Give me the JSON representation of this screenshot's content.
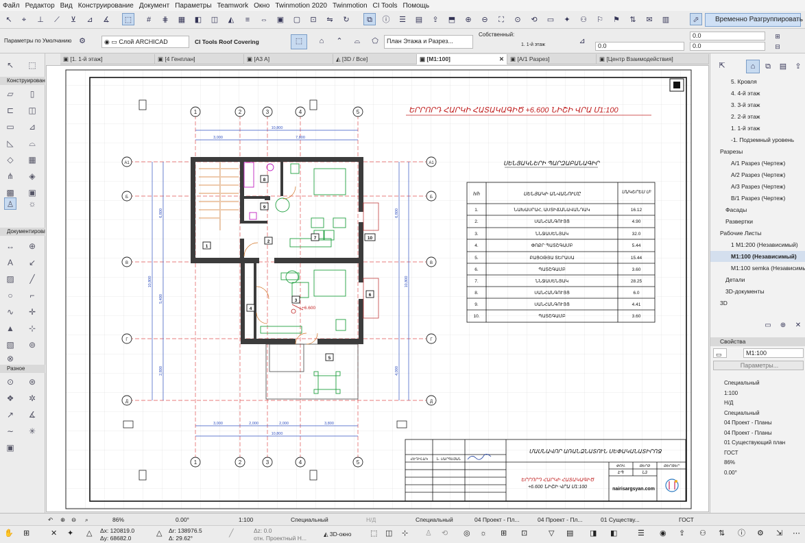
{
  "menu": [
    "Файл",
    "Редактор",
    "Вид",
    "Конструирование",
    "Документ",
    "Параметры",
    "Teamwork",
    "Окно",
    "Twinmotion 2020",
    "Twinmotion",
    "CI Tools",
    "Помощь"
  ],
  "toolbar1": {
    "regroup_label": "Временно Разгруппировать"
  },
  "toolbar2": {
    "defaults_label": "Параметры по Умолчанию",
    "layer": "Слой ARCHICAD",
    "ci_tools": "CI Tools Roof Covering",
    "view_mode": "План Этажа и Разрез...",
    "own_label": "Собственный:",
    "story": "1. 1-й этаж",
    "input1": "0.0",
    "input2": "0.0",
    "input3": "0.0"
  },
  "tabs": [
    {
      "label": "[1. 1-й этаж]"
    },
    {
      "label": "[4 Генплан]"
    },
    {
      "label": "[A3 A]"
    },
    {
      "label": "[3D / Все]"
    },
    {
      "label": "[M1:100]"
    },
    {
      "label": "[A/1 Разрез]"
    },
    {
      "label": "[Центр Взаимодействия]"
    }
  ],
  "left": {
    "design": "Конструирование",
    "document": "Документирование",
    "misc": "Разное"
  },
  "drawing": {
    "title": "ԵՐՐՈՐԴ ՀԱՐԿԻ ՀԱՏԱԿԱԳԻԾ +6.600 ՆԻՇԻ ՎՐԱ Մ1:100",
    "table_title": "ՍԵՆՅԱԿՆԵՐԻ ՊԱՐԶԱԲԱՆԱԳԻՐ",
    "col1": "h/h",
    "col2": "ՍԵՆՅԱԿԻ ԱՆՎԱՆՈՒՄԸ",
    "col3": "ՄԱԿԵՐԵՍ Մ²",
    "rows": [
      {
        "n": "1.",
        "name": "ՆԱԽԱՍՐԱՀ, ԱՍՏԻՃԱՆԱՎԱՆԴԱԿ",
        "area": "16.12"
      },
      {
        "n": "2.",
        "name": "ՍԱՆՀԱՆԳՈՒՅՑ",
        "area": "4.90"
      },
      {
        "n": "3.",
        "name": "ՆՆՋԱՍԵՆՅԱԿ",
        "area": "32.0"
      },
      {
        "n": "4.",
        "name": "ՓՈՔՐ ՊԱՏՇԳԱՄԲ",
        "area": "5.44"
      },
      {
        "n": "5.",
        "name": "ԲԱՑՕԹՅԱ ՏԵՐԱՍԱ",
        "area": "15.44"
      },
      {
        "n": "6.",
        "name": "ՊԱՏՇԳԱՄԲ",
        "area": "3.60"
      },
      {
        "n": "7.",
        "name": "ՆՆՋԱՍԵՆՅԱԿ",
        "area": "28.25"
      },
      {
        "n": "8.",
        "name": "ՍԱՆՀԱՆԳՈՒՅՑ",
        "area": "6.0"
      },
      {
        "n": "9.",
        "name": "ՍԱՆՀԱՆԳՈՒՅՑ",
        "area": "4.41"
      },
      {
        "n": "10.",
        "name": "ՊԱՏՇԳԱՄԲ",
        "area": "3.60"
      }
    ],
    "stamp_org": "ՄԱՍՆԱՎՈՐ ԱՌԱՆՁՆԱՏՈՒՆ ՍԵՓԱԿԱՆԱՏԻՐՈՋ",
    "stamp_role": "ՀԵՂԻՆԱԿ",
    "stamp_person": "Ն. ՍԱՐԳՍՅԱՆ",
    "stamp_sheet": "ԹԵՐԹ",
    "stamp_sheets": "ԹԵՐԹԵՐ",
    "stamp_stage": "ՓՈՒԼ",
    "stamp_stage_v": "ԷՊ",
    "stamp_sheet_v": "Ն3",
    "stamp_desc1": "ԵՐՐՈՐԴ ՀԱՐԿԻ ՀԱՏԱԿԱԳԻԾ",
    "stamp_desc2": "+6.600 ՆԻՇԻ ՎՐԱ Մ1:100",
    "site": "nairisargsyan.com",
    "elev": "+6.600",
    "dims_top": [
      "10,800",
      "3,000",
      "7,800"
    ],
    "dims_bottom": [
      "3,000",
      "2,000",
      "2,000",
      "3,800",
      "10,800"
    ],
    "dims_left": [
      "10,800",
      "5,400",
      "2,800",
      "6,800"
    ],
    "dims_right": [
      "10,800",
      "6,800",
      "4,000"
    ],
    "axes_top": [
      "1",
      "2",
      "3",
      "4",
      "5"
    ],
    "axes_left": [
      "A1",
      "Б",
      "B",
      "Г",
      "Д",
      "А2"
    ],
    "room_tags": [
      "1",
      "2",
      "3",
      "4",
      "5",
      "6",
      "7",
      "8",
      "9",
      "10"
    ]
  },
  "right": {
    "nav": [
      {
        "label": "5. Кровля",
        "indent": 30
      },
      {
        "label": "4. 4-й этаж",
        "indent": 30
      },
      {
        "label": "3. 3-й этаж",
        "indent": 30
      },
      {
        "label": "2. 2-й этаж",
        "indent": 30
      },
      {
        "label": "1. 1-й этаж",
        "indent": 30
      },
      {
        "label": "-1. Подземный уровень",
        "indent": 30
      },
      {
        "label": "Разрезы",
        "indent": 14
      },
      {
        "label": "А/1 Разрез (Чертеж)",
        "indent": 30
      },
      {
        "label": "А/2 Разрез (Чертеж)",
        "indent": 30
      },
      {
        "label": "А/3 Разрез (Чертеж)",
        "indent": 30
      },
      {
        "label": "B/1 Разрез (Чертеж)",
        "indent": 30
      },
      {
        "label": "Фасады",
        "indent": 22
      },
      {
        "label": "Развертки",
        "indent": 22
      },
      {
        "label": "Рабочие Листы",
        "indent": 14
      },
      {
        "label": "1 M1:200 (Независимый)",
        "indent": 30
      },
      {
        "label": "M1:100 (Независимый)",
        "indent": 30
      },
      {
        "label": "M1:100 semka (Независимый)",
        "indent": 30
      },
      {
        "label": "Детали",
        "indent": 22
      },
      {
        "label": "3D-документы",
        "indent": 22
      },
      {
        "label": "3D",
        "indent": 14
      }
    ],
    "props_title": "Свойства",
    "props_name": "M1:100",
    "props_btn": "Параметры...",
    "props": [
      "Специальный",
      "1:100",
      "Н/Д",
      "Специальный",
      "04 Проект - Планы",
      "04 Проект - Планы",
      "01 Существующий план",
      "ГОСТ",
      "86%",
      "0.00°"
    ]
  },
  "status": {
    "zoom": "86%",
    "angle": "0.00°",
    "scale": "1:100",
    "special1": "Специальный",
    "nd": "Н/Д",
    "special2": "Специальный",
    "proj1": "04 Проект - Пл...",
    "proj2": "04 Проект - Пл...",
    "exist": "01 Существу...",
    "gost": "ГОСТ"
  },
  "bottom": {
    "x": "Δx: 120819.0",
    "y": "Δy: 68682.0",
    "r": "Δr: 138976.5",
    "a": "Δ: 29.62°",
    "z": "Δz: 0.0",
    "ref": "отн. Проектный Н...",
    "window3d": "3D-окно"
  }
}
